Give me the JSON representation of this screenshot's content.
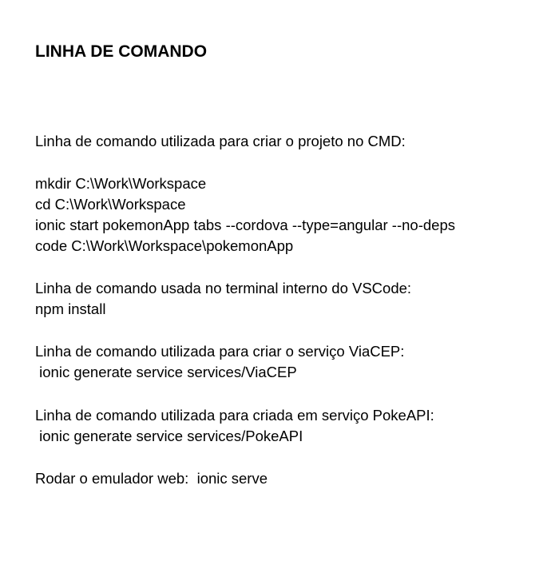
{
  "document": {
    "title": "LINHA DE COMANDO",
    "lines": [
      "Linha de comando utilizada para criar o projeto no CMD:",
      "mkdir C:\\Work\\Workspace",
      "cd C:\\Work\\Workspace",
      "ionic start pokemonApp tabs --cordova --type=angular --no-deps",
      "code C:\\Work\\Workspace\\pokemonApp",
      "Linha de comando usada no terminal interno do VSCode:",
      "npm install",
      "Linha de comando utilizada para criar o serviço ViaCEP:",
      " ionic generate service services/ViaCEP",
      "Linha de comando utilizada para criada em serviço PokeAPI:",
      " ionic generate service services/PokeAPI",
      "Rodar o emulador web:  ionic serve"
    ]
  }
}
